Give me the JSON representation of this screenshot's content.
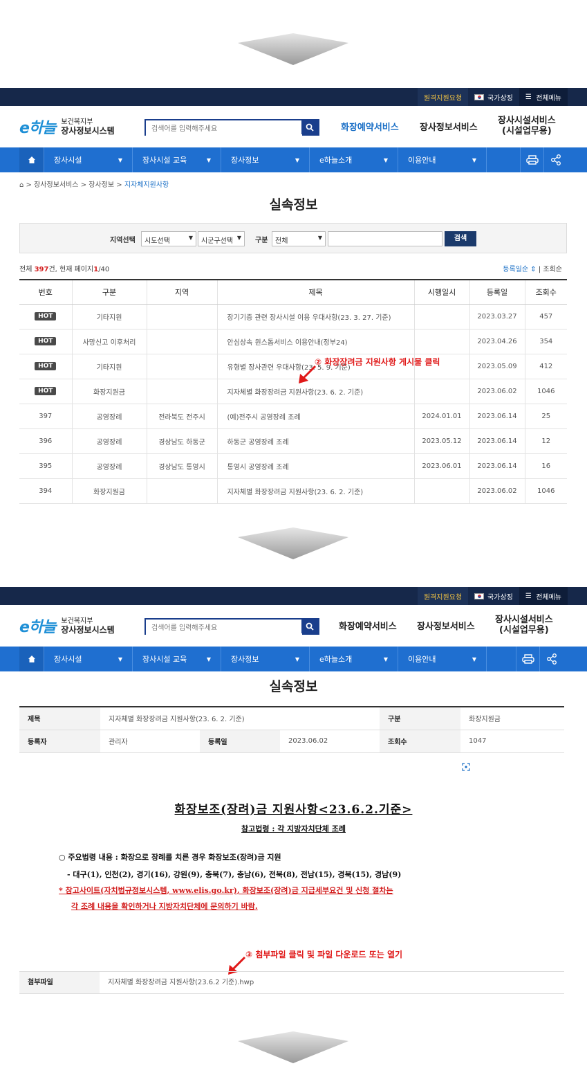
{
  "header": {
    "remote_support": "원격지원요청",
    "national_symbol": "국가상징",
    "full_menu": "전체메뉴",
    "logo_mark": "e하늘",
    "logo_line1": "보건복지부",
    "logo_line2": "장사정보시스템",
    "search_placeholder": "검색어를 입력해주세요",
    "svc1": "화장예약서비스",
    "svc2": "장사정보서비스",
    "svc3_line1": "장사시설서비스",
    "svc3_line2": "(시설업무용)"
  },
  "gnb": {
    "items": [
      "장사시설",
      "장사시설 교육",
      "장사정보",
      "e하늘소개",
      "이용안내"
    ]
  },
  "breadcrumb": {
    "a": "장사정보서비스",
    "b": "장사정보",
    "c": "지자체지원사항"
  },
  "page_title": "실속정보",
  "filter": {
    "region_label": "지역선택",
    "sido": "시도선택",
    "sigungu": "시군구선택",
    "cat_label": "구분",
    "cat_value": "전체",
    "search_btn": "검색"
  },
  "count": {
    "pre": "전체 ",
    "total": "397",
    "mid": "건, 현재 페이지",
    "page": "1",
    "post": "/40"
  },
  "sort": {
    "reg": "등록일순",
    "views": "조회순"
  },
  "columns": [
    "번호",
    "구분",
    "지역",
    "제목",
    "시행일시",
    "등록일",
    "조회수"
  ],
  "rows": [
    {
      "no": "HOT",
      "cat": "기타지원",
      "region": "",
      "title": "장기기증 관련 장사시설 이용 우대사항(23. 3. 27. 기준)",
      "date": "",
      "reg": "2023.03.27",
      "views": "457"
    },
    {
      "no": "HOT",
      "cat": "사망신고 이후처리",
      "region": "",
      "title": "안심상속 원스톱서비스 이용안내(정부24)",
      "date": "",
      "reg": "2023.04.26",
      "views": "354"
    },
    {
      "no": "HOT",
      "cat": "기타지원",
      "region": "",
      "title": "유형별 장사관련 우대사항(23. 5. 9. 기준)",
      "date": "",
      "reg": "2023.05.09",
      "views": "412"
    },
    {
      "no": "HOT",
      "cat": "화장지원금",
      "region": "",
      "title": "지자체별 화장장려금 지원사항(23. 6. 2. 기준)",
      "date": "",
      "reg": "2023.06.02",
      "views": "1046"
    },
    {
      "no": "397",
      "cat": "공영장례",
      "region": "전라북도 전주시",
      "title": "(예)전주시 공영장례 조례",
      "date": "2024.01.01",
      "reg": "2023.06.14",
      "views": "25"
    },
    {
      "no": "396",
      "cat": "공영장례",
      "region": "경상남도 하동군",
      "title": "하동군 공영장례 조례",
      "date": "2023.05.12",
      "reg": "2023.06.14",
      "views": "12"
    },
    {
      "no": "395",
      "cat": "공영장례",
      "region": "경상남도 통영시",
      "title": "통영시 공영장례 조례",
      "date": "2023.06.01",
      "reg": "2023.06.14",
      "views": "16"
    },
    {
      "no": "394",
      "cat": "화장지원금",
      "region": "",
      "title": "지자체별 화장장려금 지원사항(23. 6. 2. 기준)",
      "date": "",
      "reg": "2023.06.02",
      "views": "1046"
    }
  ],
  "annotation2": "② 화장장려금 지원사항 게시물 클릭",
  "annotation3": "③ 첨부파일 클릭 및 파일 다운로드 또는 열기",
  "detail": {
    "title_label": "제목",
    "title_value": "지자체별 화장장려금 지원사항(23. 6. 2. 기준)",
    "cat_label": "구분",
    "cat_value": "화장지원금",
    "author_label": "등록자",
    "author_value": "관리자",
    "reg_label": "등록일",
    "reg_value": "2023.06.02",
    "views_label": "조회수",
    "views_value": "1047"
  },
  "doc": {
    "title": "화장보조(장려)금 지원사항<23.6.2.기준>",
    "subtitle": "참고법령 : 각 지방자치단체 조례",
    "line1": "○ 주요법령 내용 : 화장으로 장례를 치른 경우 화장보조(장려)금 지원",
    "line2": "- 대구(1), 인천(2), 경기(16), 강원(9), 충북(7), 충남(6), 전북(8), 전남(15), 경북(15), 경남(9)",
    "line3": "* 참고사이트(자치법규정보시스템, www.elis.go.kr), 화장보조(장려)금 지급세부요건 및 신청 절차는",
    "line4": "각 조례 내용을 확인하거나 지방자치단체에 문의하기 바람."
  },
  "attachment": {
    "label": "첨부파일",
    "file": "지자체별 화장장려금 지원사항(23.6.2 기준).hwp"
  }
}
